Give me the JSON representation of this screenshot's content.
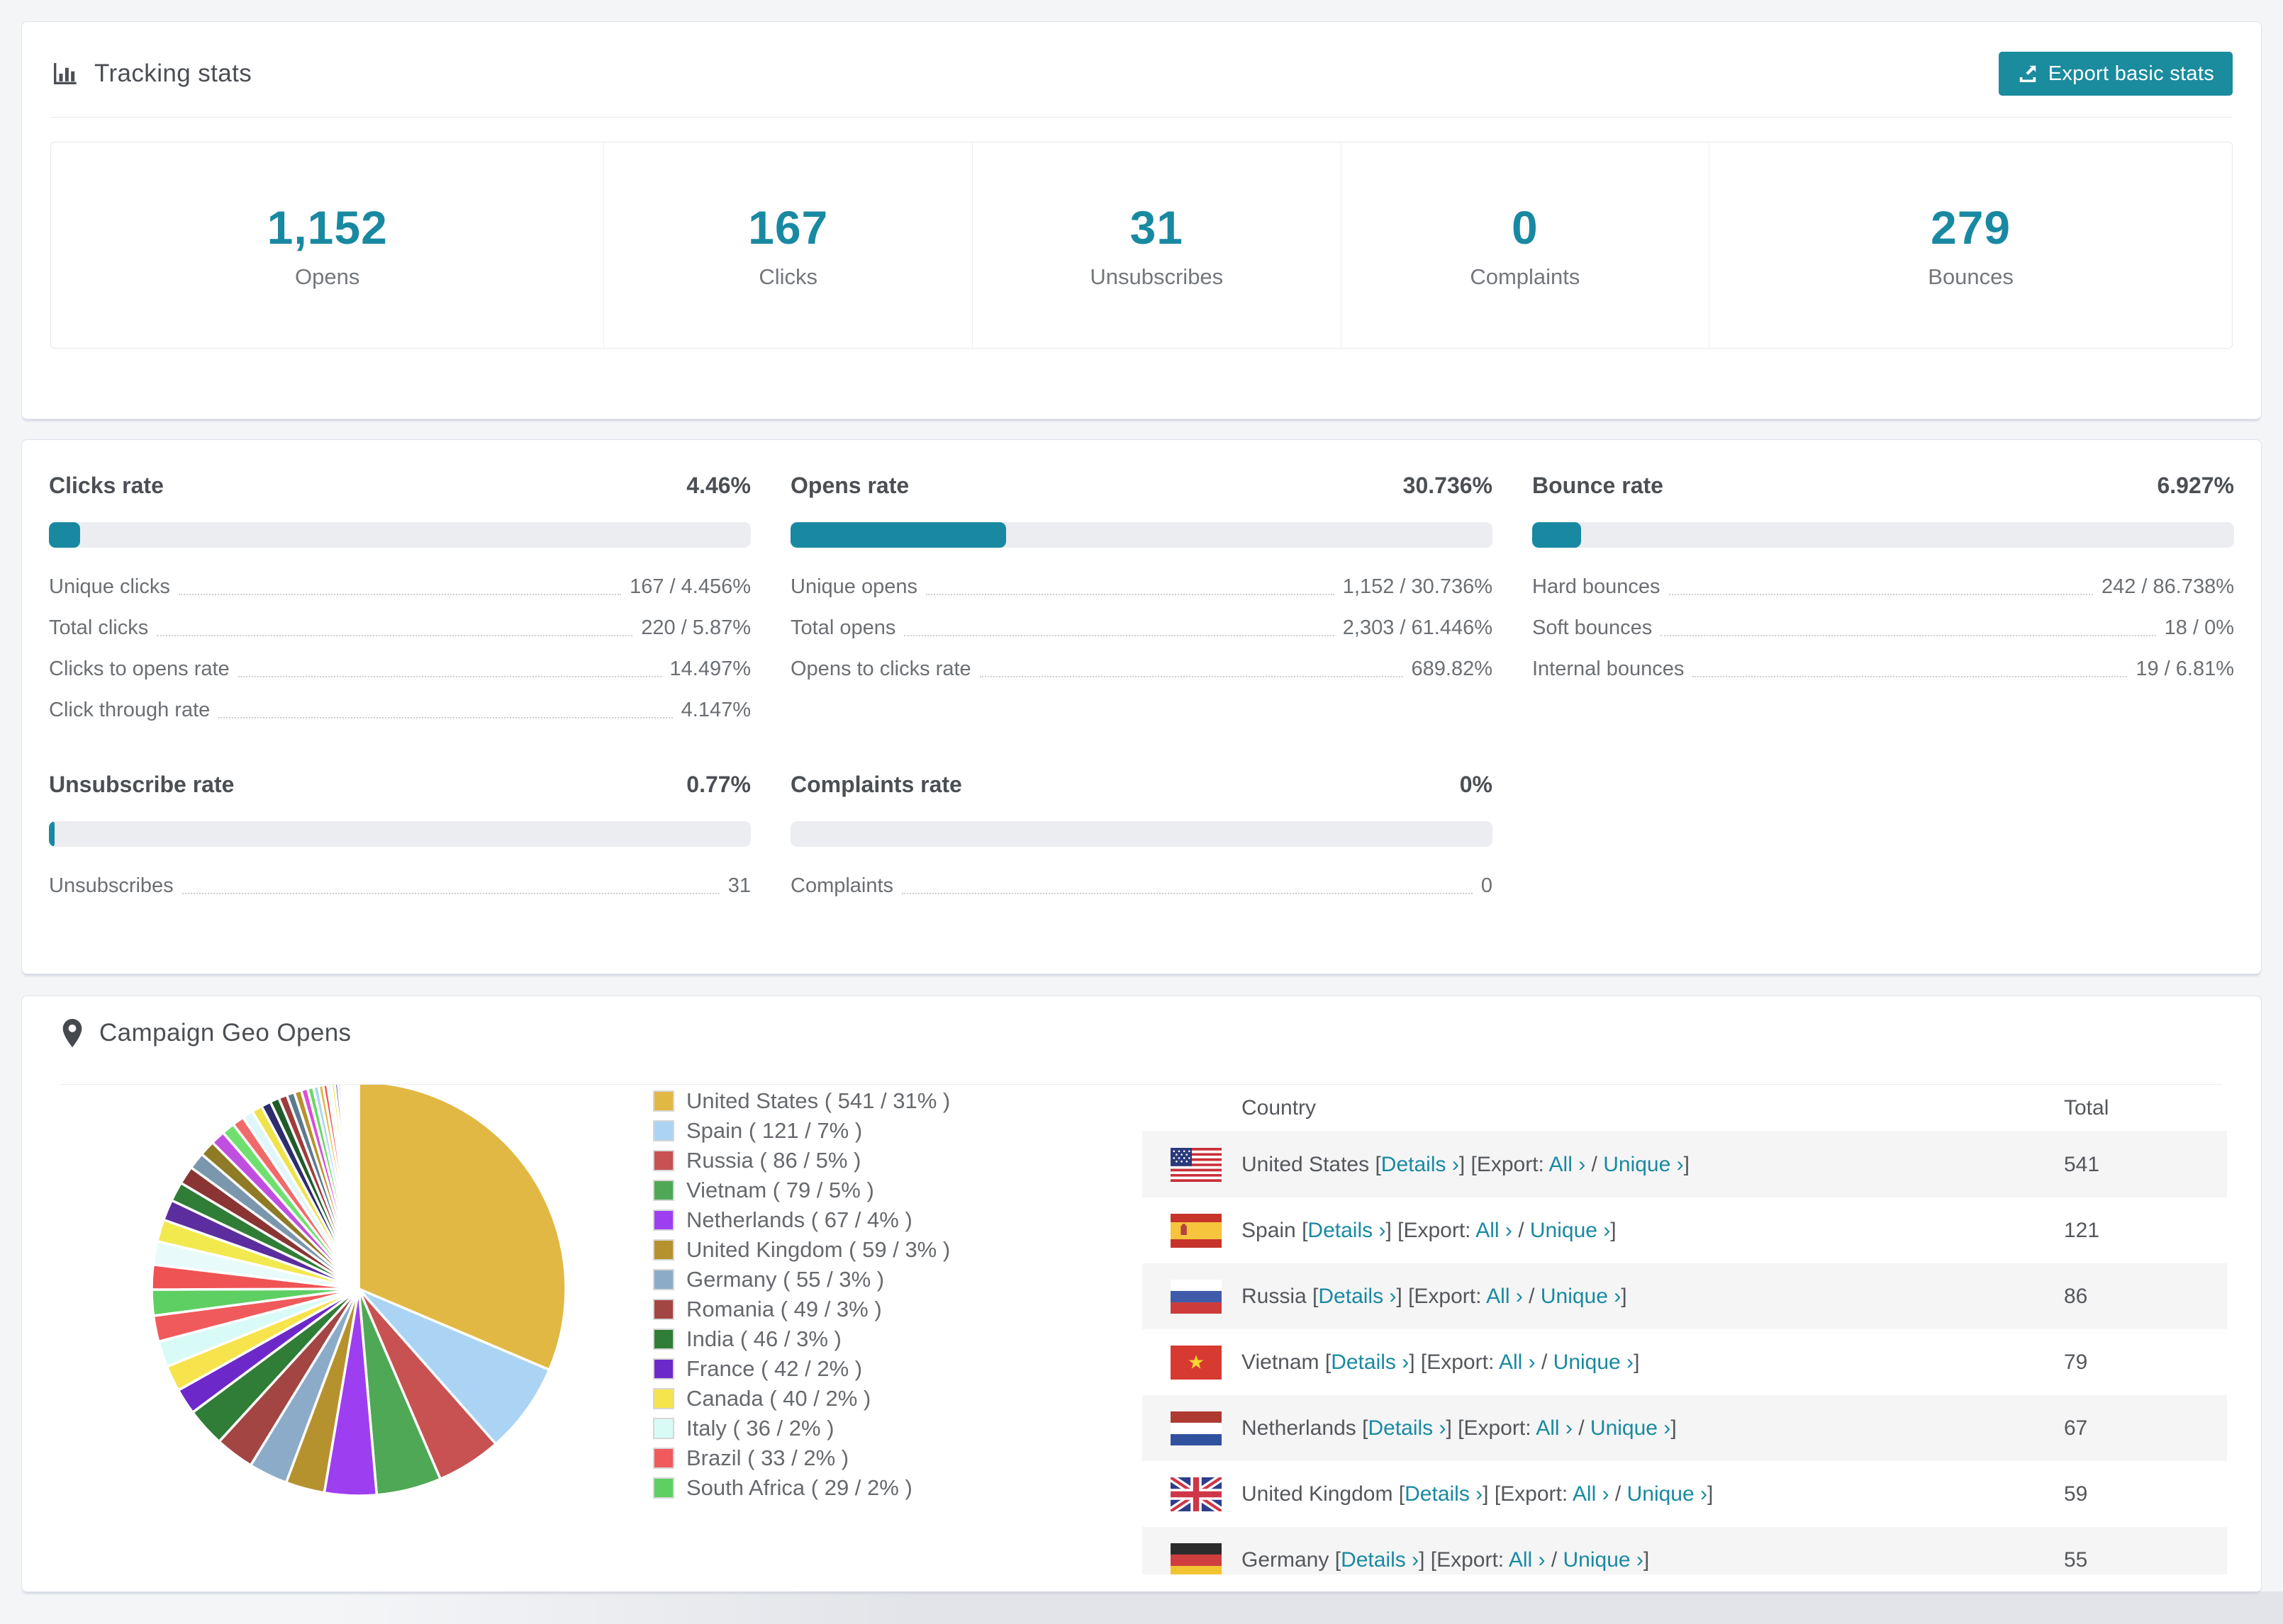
{
  "colors": {
    "accent": "#1989a2",
    "button_bg": "#1b8b9e",
    "bar_track": "#ebedf0",
    "zebra_row": "#f5f5f6",
    "text_dark": "#4b4f54",
    "text_muted": "#6b6f73"
  },
  "tracking": {
    "title": "Tracking stats",
    "export_button": "Export basic stats",
    "summary": [
      {
        "value": "1,152",
        "label": "Opens"
      },
      {
        "value": "167",
        "label": "Clicks"
      },
      {
        "value": "31",
        "label": "Unsubscribes"
      },
      {
        "value": "0",
        "label": "Complaints"
      },
      {
        "value": "279",
        "label": "Bounces"
      }
    ]
  },
  "rates": [
    {
      "title": "Clicks rate",
      "value": "4.46%",
      "percent": 4.46,
      "rows": [
        [
          "Unique clicks",
          "167 / 4.456%"
        ],
        [
          "Total clicks",
          "220 / 5.87%"
        ],
        [
          "Clicks to opens rate",
          "14.497%"
        ],
        [
          "Click through rate",
          "4.147%"
        ]
      ]
    },
    {
      "title": "Opens rate",
      "value": "30.736%",
      "percent": 30.736,
      "rows": [
        [
          "Unique opens",
          "1,152 / 30.736%"
        ],
        [
          "Total opens",
          "2,303 / 61.446%"
        ],
        [
          "Opens to clicks rate",
          "689.82%"
        ]
      ]
    },
    {
      "title": "Bounce rate",
      "value": "6.927%",
      "percent": 6.927,
      "rows": [
        [
          "Hard bounces",
          "242 / 86.738%"
        ],
        [
          "Soft bounces",
          "18 / 0%"
        ],
        [
          "Internal bounces",
          "19 / 6.81%"
        ]
      ]
    },
    {
      "title": "Unsubscribe rate",
      "value": "0.77%",
      "percent": 0.77,
      "rows": [
        [
          "Unsubscribes",
          "31"
        ]
      ]
    },
    {
      "title": "Complaints rate",
      "value": "0%",
      "percent": 0,
      "rows": [
        [
          "Complaints",
          "0"
        ]
      ]
    }
  ],
  "geo": {
    "title": "Campaign Geo Opens",
    "chart_data": {
      "type": "pie",
      "legend_position": "right",
      "start_angle_deg": -90,
      "slices": [
        {
          "label": "United States ( 541 / 31% )",
          "country": "United States",
          "count": 541,
          "percent": 31,
          "color": "#e2b844"
        },
        {
          "label": "Spain ( 121 / 7% )",
          "country": "Spain",
          "count": 121,
          "percent": 7,
          "color": "#abd4f4"
        },
        {
          "label": "Russia ( 86 / 5% )",
          "country": "Russia",
          "count": 86,
          "percent": 5,
          "color": "#c85152"
        },
        {
          "label": "Vietnam ( 79 / 5% )",
          "country": "Vietnam",
          "count": 79,
          "percent": 5,
          "color": "#4fa855"
        },
        {
          "label": "Netherlands ( 67 / 4% )",
          "country": "Netherlands",
          "count": 67,
          "percent": 4,
          "color": "#9d3ef0"
        },
        {
          "label": "United Kingdom ( 59 / 3% )",
          "country": "United Kingdom",
          "count": 59,
          "percent": 3,
          "color": "#b6922e"
        },
        {
          "label": "Germany ( 55 / 3% )",
          "country": "Germany",
          "count": 55,
          "percent": 3,
          "color": "#8cabc9"
        },
        {
          "label": "Romania ( 49 / 3% )",
          "country": "Romania",
          "count": 49,
          "percent": 3,
          "color": "#a34543"
        },
        {
          "label": "India ( 46 / 3% )",
          "country": "India",
          "count": 46,
          "percent": 3,
          "color": "#2f7d36"
        },
        {
          "label": "France ( 42 / 2% )",
          "country": "France",
          "count": 42,
          "percent": 2,
          "color": "#6d28c9"
        },
        {
          "label": "Canada ( 40 / 2% )",
          "country": "Canada",
          "count": 40,
          "percent": 2,
          "color": "#f7e34c"
        },
        {
          "label": "Italy ( 36 / 2% )",
          "country": "Italy",
          "count": 36,
          "percent": 2,
          "color": "#d9fbf8"
        },
        {
          "label": "Brazil ( 33 / 2% )",
          "country": "Brazil",
          "count": 33,
          "percent": 2,
          "color": "#f05a5c"
        },
        {
          "label": "South Africa ( 29 / 2% )",
          "country": "South Africa",
          "count": 29,
          "percent": 2,
          "color": "#5ecf63"
        }
      ],
      "tail_values": [
        1.9,
        1.8,
        1.7,
        1.6,
        1.5,
        1.4,
        1.3,
        1.2,
        1.1,
        1.0,
        0.9,
        0.85,
        0.8,
        0.75,
        0.7,
        0.65,
        0.6,
        0.55,
        0.5,
        0.45,
        0.4,
        0.36,
        0.33,
        0.3,
        0.27,
        0.24,
        0.21,
        0.19,
        0.17,
        0.15,
        0.13,
        0.11,
        0.1,
        0.09,
        0.08,
        0.07,
        0.06,
        0.05,
        0.04,
        0.035,
        0.03,
        0.025,
        0.02,
        0.015,
        0.01
      ],
      "tail_palette": [
        "#ef5354",
        "#e8fbfa",
        "#f2e94e",
        "#5b2d9e",
        "#2f7d36",
        "#8a3434",
        "#7b97ad",
        "#8f7b26",
        "#c04fe0",
        "#6fdf6f",
        "#f06a6a",
        "#dff6fb",
        "#efe24a",
        "#2c2c6e",
        "#1f5c2a",
        "#9e3c3c",
        "#5a7a8f",
        "#b6922e",
        "#d84fd8",
        "#66d966",
        "#abd4f4",
        "#e2b844"
      ]
    },
    "table": {
      "headers": [
        "Country",
        "Total"
      ],
      "link_labels": {
        "open_bracket": "[",
        "details": "Details ›",
        "export_mid": "] [Export: ",
        "all": "All ›",
        "sep": " / ",
        "unique": "Unique ›",
        "close_bracket": "]"
      },
      "rows": [
        {
          "country": "United States",
          "code": "us",
          "total": "541"
        },
        {
          "country": "Spain",
          "code": "es",
          "total": "121"
        },
        {
          "country": "Russia",
          "code": "ru",
          "total": "86"
        },
        {
          "country": "Vietnam",
          "code": "vn",
          "total": "79"
        },
        {
          "country": "Netherlands",
          "code": "nl",
          "total": "67"
        },
        {
          "country": "United Kingdom",
          "code": "gb",
          "total": "59"
        },
        {
          "country": "Germany",
          "code": "de",
          "total": "55"
        }
      ]
    }
  }
}
